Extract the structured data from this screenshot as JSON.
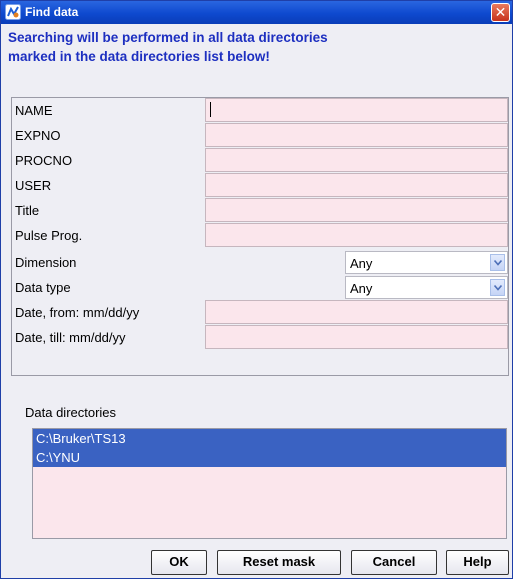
{
  "window": {
    "title": "Find data",
    "close_glyph": "✕"
  },
  "notice": {
    "line1": "Searching will be performed in all data directories",
    "line2": "marked in the data directories list below!"
  },
  "fields": {
    "name": {
      "label": "NAME",
      "value": ""
    },
    "expno": {
      "label": "EXPNO",
      "value": ""
    },
    "procno": {
      "label": "PROCNO",
      "value": ""
    },
    "user": {
      "label": "USER",
      "value": ""
    },
    "title": {
      "label": "Title",
      "value": ""
    },
    "pulse_prog": {
      "label": "Pulse Prog.",
      "value": ""
    },
    "dimension": {
      "label": "Dimension",
      "selected": "Any"
    },
    "data_type": {
      "label": "Data type",
      "selected": "Any"
    },
    "date_from": {
      "label": "Date, from: mm/dd/yy",
      "value": ""
    },
    "date_till": {
      "label": "Date, till: mm/dd/yy",
      "value": ""
    }
  },
  "data_directories": {
    "label": "Data directories",
    "items": [
      "C:\\Bruker\\TS13",
      "C:\\YNU"
    ]
  },
  "buttons": {
    "ok": "OK",
    "reset_mask": "Reset mask",
    "cancel": "Cancel",
    "help": "Help"
  },
  "colors": {
    "title_bar": "#0e49cf",
    "notice_text": "#1d2fc0",
    "field_background": "#fbe6ec",
    "selection": "#3a62c2"
  },
  "icons": [
    "app-icon",
    "close-icon",
    "chevron-down-icon"
  ]
}
